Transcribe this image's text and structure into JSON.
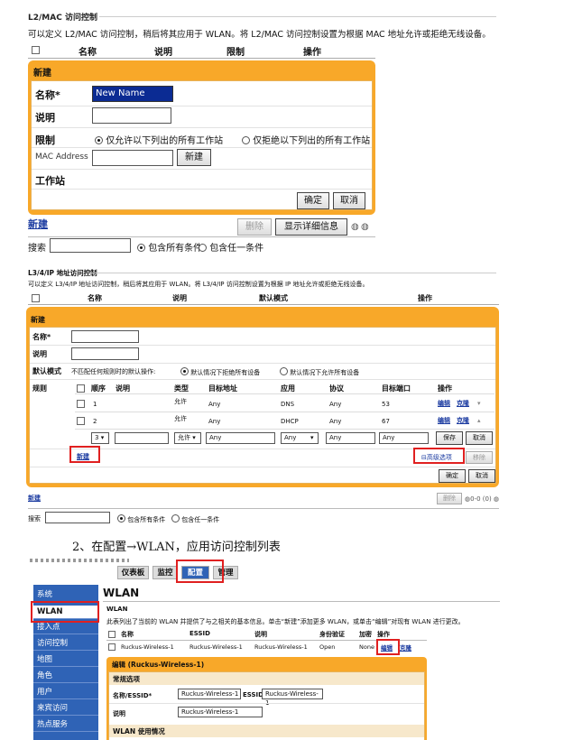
{
  "s1": {
    "title": "L2/MAC 访问控制",
    "desc": "可以定义 L2/MAC 访问控制，稍后将其应用于 WLAN。将 L2/MAC 访问控制设置为根据 MAC 地址允许或拒绝无线设备。",
    "cols": [
      "名称",
      "说明",
      "限制",
      "操作"
    ],
    "panel_title": "新建",
    "name_label": "名称*",
    "name_value": "New Name",
    "desc_label": "说明",
    "restrict_label": "限制",
    "allow_opt": "仅允许以下列出的所有工作站",
    "deny_opt": "仅拒绝以下列出的所有工作站",
    "mac_label": "MAC Address",
    "create_btn": "新建",
    "station_label": "工作站",
    "ok_btn": "确定",
    "cancel_btn": "取消",
    "new_link": "新建",
    "delete_btn": "删除",
    "details_btn": "显示详细信息",
    "search_label": "搜索",
    "all_opt": "包含所有条件",
    "any_opt": "包含任一条件"
  },
  "s2": {
    "title": "L3/4/IP 地址访问控制",
    "desc": "可以定义 L3/4/IP 地址访问控制，稍后将其应用于 WLAN。将 L3/4/IP 访问控制设置为根据 IP 地址允许或拒绝无线设备。",
    "cols": [
      "名称",
      "说明",
      "默认模式",
      "操作"
    ],
    "panel_title": "新建",
    "name_label": "名称*",
    "desc_label": "说明",
    "mode_label": "默认模式",
    "mode_text": "不匹配任何规则时的默认操作:",
    "mode_deny": "默认情况下拒绝所有设备",
    "mode_allow": "默认情况下允许所有设备",
    "rules_label": "规则",
    "rule_cols": [
      "顺序",
      "说明",
      "类型",
      "目标地址",
      "应用",
      "协议",
      "目标端口",
      "操作"
    ],
    "rules": [
      {
        "order": "1",
        "desc": "",
        "type": "允许",
        "dest": "Any",
        "app": "DNS",
        "proto": "Any",
        "port": "53"
      },
      {
        "order": "2",
        "desc": "",
        "type": "允许",
        "dest": "Any",
        "app": "DHCP",
        "proto": "Any",
        "port": "67"
      }
    ],
    "edit_link": "编辑",
    "clone_link": "克隆",
    "new_row": {
      "order": "3",
      "type": "允许",
      "dest": "Any",
      "app": "Any",
      "proto": "Any",
      "port": "Any"
    },
    "save_btn": "保存",
    "cancel_row_btn": "取消",
    "new_link": "新建",
    "advanced": "高级选项",
    "remove_btn": "移除",
    "ok_btn": "确定",
    "cancel_btn": "取消",
    "new_link2": "新建",
    "delete_btn": "删除",
    "count": "0-0 (0)",
    "search_label": "搜索",
    "all_opt": "包含所有条件",
    "any_opt": "包含任一条件"
  },
  "step": "2、在配置→WLAN，应用访问控制列表",
  "s3": {
    "tabs": [
      "仪表板",
      "监控",
      "配置",
      "管理"
    ],
    "sidebar": [
      "系统",
      "WLAN",
      "接入点",
      "访问控制",
      "地图",
      "角色",
      "用户",
      "来宾访问",
      "热点服务"
    ],
    "heading": "WLAN",
    "sub": "WLAN",
    "desc": "此表列出了当前的 WLAN 并提供了与之相关的基本信息。单击“新建”添加更多 WLAN，或单击“编辑”对现有 WLAN 进行更改。",
    "cols": [
      "名称",
      "ESSID",
      "说明",
      "身份验证",
      "加密",
      "操作"
    ],
    "row": {
      "name": "Ruckus-Wireless-1",
      "essid": "Ruckus-Wireless-1",
      "desc": "Ruckus-Wireless-1",
      "auth": "Open",
      "enc": "None"
    },
    "edit_link": "编辑",
    "clone_link": "克隆",
    "edit_title": "编辑 (Ruckus-Wireless-1)",
    "general": "常规选项",
    "name_label": "名称/ESSID*",
    "name_value": "Ruckus-Wireless-1",
    "essid_label": "ESSID",
    "essid_value": "Ruckus-Wireless-1",
    "desc_label": "说明",
    "desc_value": "Ruckus-Wireless-1",
    "usage": "WLAN 使用情况"
  },
  "colors": {
    "orange": "#f8a829",
    "red": "#e02020",
    "blue": "#2f63b6",
    "link": "#1a3aa0"
  }
}
